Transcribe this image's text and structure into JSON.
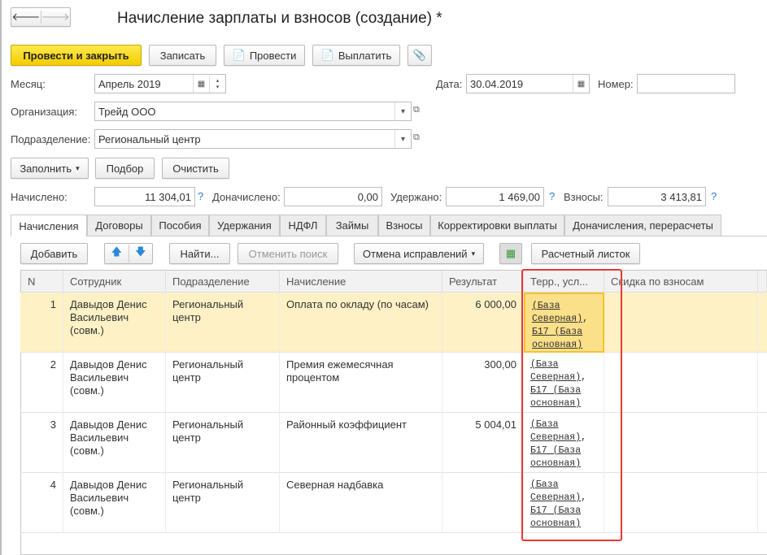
{
  "title": "Начисление зарплаты и взносов (создание) *",
  "toolbar": {
    "post_close": "Провести и закрыть",
    "save": "Записать",
    "post": "Провести",
    "pay": "Выплатить"
  },
  "fields": {
    "month_label": "Месяц:",
    "month": "Апрель 2019",
    "date_label": "Дата:",
    "date": "30.04.2019",
    "number_label": "Номер:",
    "number": "",
    "org_label": "Организация:",
    "org": "Трейд ООО",
    "dept_label": "Подразделение:",
    "dept": "Региональный центр"
  },
  "actions": {
    "fill": "Заполнить",
    "select": "Подбор",
    "clear": "Очистить"
  },
  "totals": {
    "accrued_label": "Начислено:",
    "accrued": "11 304,01",
    "extra_label": "Доначислено:",
    "extra": "0,00",
    "withheld_label": "Удержано:",
    "withheld": "1 469,00",
    "contrib_label": "Взносы:",
    "contrib": "3 413,81",
    "help": "?"
  },
  "tabs": [
    "Начисления",
    "Договоры",
    "Пособия",
    "Удержания",
    "НДФЛ",
    "Займы",
    "Взносы",
    "Корректировки выплаты",
    "Доначисления, перерасчеты"
  ],
  "table_toolbar": {
    "add": "Добавить",
    "find": "Найти...",
    "cancel_search": "Отменить поиск",
    "undo": "Отмена исправлений",
    "payslip": "Расчетный листок"
  },
  "columns": [
    "N",
    "Сотрудник",
    "Подразделение",
    "Начисление",
    "Результат",
    "Терр., усл...",
    "Скидка по взносам"
  ],
  "rows": [
    {
      "n": "1",
      "employee": "Давыдов Денис Васильевич (совм.)",
      "dept": "Региональный центр",
      "accrual": "Оплата по окладу (по часам)",
      "result": "6 000,00",
      "terr1": "(База",
      "terr2": "Северная)",
      "terr3": "Б17 (База",
      "terr4": "основная)"
    },
    {
      "n": "2",
      "employee": "Давыдов Денис Васильевич (совм.)",
      "dept": "Региональный центр",
      "accrual": "Премия ежемесячная процентом",
      "result": "300,00",
      "terr1": "(База",
      "terr2": "Северная)",
      "terr3": "Б17 (База",
      "terr4": "основная)"
    },
    {
      "n": "3",
      "employee": "Давыдов Денис Васильевич (совм.)",
      "dept": "Региональный центр",
      "accrual": "Районный коэффициент",
      "result": "5 004,01",
      "terr1": "(База",
      "terr2": "Северная)",
      "terr3": "Б17 (База",
      "terr4": "основная)"
    },
    {
      "n": "4",
      "employee": "Давыдов Денис Васильевич (совм.)",
      "dept": "Региональный центр",
      "accrual": "Северная надбавка",
      "result": "",
      "terr1": "(База",
      "terr2": "Северная)",
      "terr3": "Б17 (База",
      "terr4": "основная)"
    }
  ]
}
